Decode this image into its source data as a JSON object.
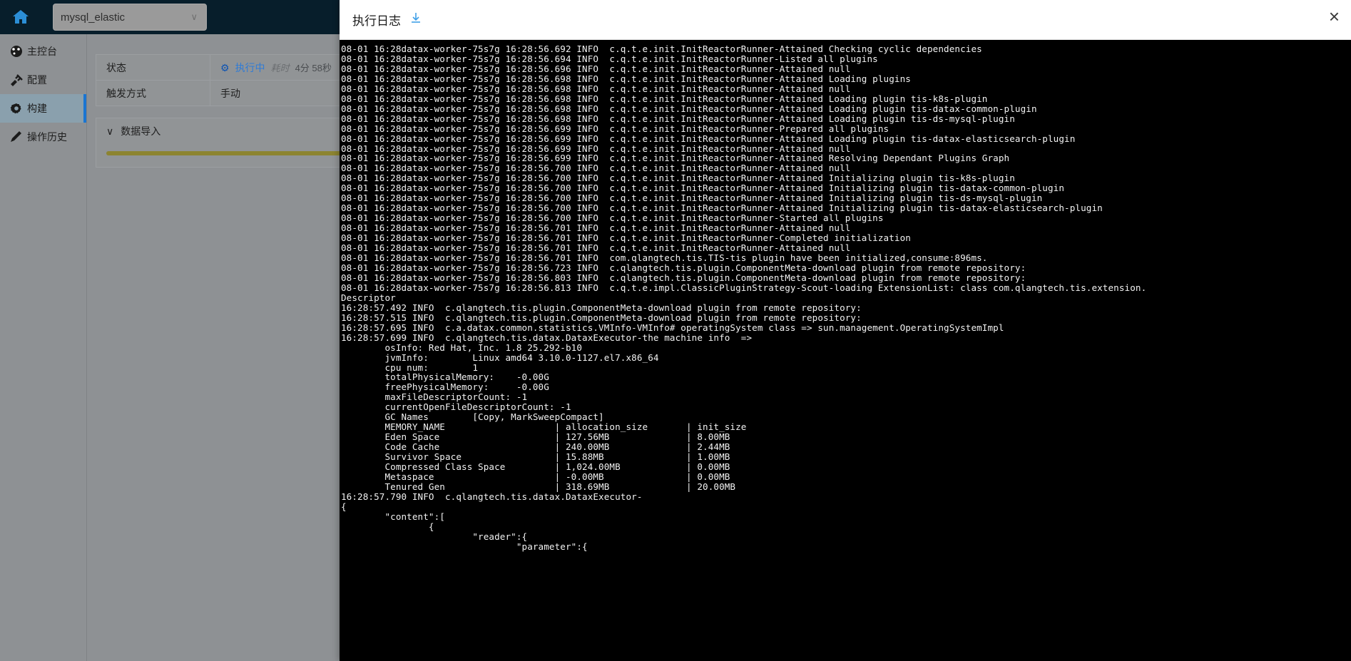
{
  "topbar": {
    "home_icon": "home-icon",
    "project_select": {
      "value": "mysql_elastic",
      "chevron": "∨"
    }
  },
  "sidebar": {
    "items": [
      {
        "label": "主控台",
        "icon": "dashboard-icon",
        "active": false
      },
      {
        "label": "配置",
        "icon": "plug-icon",
        "active": false
      },
      {
        "label": "构建",
        "icon": "gear-icon",
        "active": true
      },
      {
        "label": "操作历史",
        "icon": "pencil-icon",
        "active": false
      }
    ]
  },
  "main": {
    "info_rows": [
      {
        "label": "状态",
        "value": "执行中",
        "elapsed_prefix": "耗时",
        "elapsed_value": "4分 58秒",
        "gear": "⚙"
      },
      {
        "label": "触发方式",
        "value": "手动"
      }
    ],
    "panel": {
      "chevron": "∨",
      "title": "数据导入",
      "progress": 62
    }
  },
  "log_modal": {
    "title": "执行日志",
    "download_icon": "download-icon",
    "close_icon": "close-icon",
    "lines": [
      "08-01 16:28datax-worker-75s7g 16:28:56.692 INFO  c.q.t.e.init.InitReactorRunner-Attained Checking cyclic dependencies",
      "08-01 16:28datax-worker-75s7g 16:28:56.694 INFO  c.q.t.e.init.InitReactorRunner-Listed all plugins",
      "08-01 16:28datax-worker-75s7g 16:28:56.696 INFO  c.q.t.e.init.InitReactorRunner-Attained null",
      "08-01 16:28datax-worker-75s7g 16:28:56.698 INFO  c.q.t.e.init.InitReactorRunner-Attained Loading plugins",
      "08-01 16:28datax-worker-75s7g 16:28:56.698 INFO  c.q.t.e.init.InitReactorRunner-Attained null",
      "08-01 16:28datax-worker-75s7g 16:28:56.698 INFO  c.q.t.e.init.InitReactorRunner-Attained Loading plugin tis-k8s-plugin",
      "08-01 16:28datax-worker-75s7g 16:28:56.698 INFO  c.q.t.e.init.InitReactorRunner-Attained Loading plugin tis-datax-common-plugin",
      "08-01 16:28datax-worker-75s7g 16:28:56.698 INFO  c.q.t.e.init.InitReactorRunner-Attained Loading plugin tis-ds-mysql-plugin",
      "08-01 16:28datax-worker-75s7g 16:28:56.699 INFO  c.q.t.e.init.InitReactorRunner-Prepared all plugins",
      "08-01 16:28datax-worker-75s7g 16:28:56.699 INFO  c.q.t.e.init.InitReactorRunner-Attained Loading plugin tis-datax-elasticsearch-plugin",
      "08-01 16:28datax-worker-75s7g 16:28:56.699 INFO  c.q.t.e.init.InitReactorRunner-Attained null",
      "08-01 16:28datax-worker-75s7g 16:28:56.699 INFO  c.q.t.e.init.InitReactorRunner-Attained Resolving Dependant Plugins Graph",
      "08-01 16:28datax-worker-75s7g 16:28:56.700 INFO  c.q.t.e.init.InitReactorRunner-Attained null",
      "08-01 16:28datax-worker-75s7g 16:28:56.700 INFO  c.q.t.e.init.InitReactorRunner-Attained Initializing plugin tis-k8s-plugin",
      "08-01 16:28datax-worker-75s7g 16:28:56.700 INFO  c.q.t.e.init.InitReactorRunner-Attained Initializing plugin tis-datax-common-plugin",
      "08-01 16:28datax-worker-75s7g 16:28:56.700 INFO  c.q.t.e.init.InitReactorRunner-Attained Initializing plugin tis-ds-mysql-plugin",
      "08-01 16:28datax-worker-75s7g 16:28:56.700 INFO  c.q.t.e.init.InitReactorRunner-Attained Initializing plugin tis-datax-elasticsearch-plugin",
      "08-01 16:28datax-worker-75s7g 16:28:56.700 INFO  c.q.t.e.init.InitReactorRunner-Started all plugins",
      "08-01 16:28datax-worker-75s7g 16:28:56.701 INFO  c.q.t.e.init.InitReactorRunner-Attained null",
      "08-01 16:28datax-worker-75s7g 16:28:56.701 INFO  c.q.t.e.init.InitReactorRunner-Completed initialization",
      "08-01 16:28datax-worker-75s7g 16:28:56.701 INFO  c.q.t.e.init.InitReactorRunner-Attained null",
      "08-01 16:28datax-worker-75s7g 16:28:56.701 INFO  com.qlangtech.tis.TIS-tis plugin have been initialized,consume:896ms.",
      "08-01 16:28datax-worker-75s7g 16:28:56.723 INFO  c.qlangtech.tis.plugin.ComponentMeta-download plugin from remote repository:",
      "08-01 16:28datax-worker-75s7g 16:28:56.803 INFO  c.qlangtech.tis.plugin.ComponentMeta-download plugin from remote repository:",
      "08-01 16:28datax-worker-75s7g 16:28:56.813 INFO  c.q.t.e.impl.ClassicPluginStrategy-Scout-loading ExtensionList: class com.qlangtech.tis.extension.",
      "Descriptor",
      "16:28:57.492 INFO  c.qlangtech.tis.plugin.ComponentMeta-download plugin from remote repository:",
      "16:28:57.515 INFO  c.qlangtech.tis.plugin.ComponentMeta-download plugin from remote repository:",
      "16:28:57.695 INFO  c.a.datax.common.statistics.VMInfo-VMInfo# operatingSystem class => sun.management.OperatingSystemImpl",
      "16:28:57.699 INFO  c.qlangtech.tis.datax.DataxExecutor-the machine info  =>",
      "        osInfo: Red Hat, Inc. 1.8 25.292-b10",
      "        jvmInfo:        Linux amd64 3.10.0-1127.el7.x86_64",
      "        cpu num:        1",
      "        totalPhysicalMemory:    -0.00G",
      "        freePhysicalMemory:     -0.00G",
      "        maxFileDescriptorCount: -1",
      "        currentOpenFileDescriptorCount: -1",
      "        GC Names        [Copy, MarkSweepCompact]",
      "        MEMORY_NAME                    | allocation_size       | init_size",
      "        Eden Space                     | 127.56MB              | 8.00MB",
      "        Code Cache                     | 240.00MB              | 2.44MB",
      "        Survivor Space                 | 15.88MB               | 1.00MB",
      "        Compressed Class Space         | 1,024.00MB            | 0.00MB",
      "        Metaspace                      | -0.00MB               | 0.00MB",
      "        Tenured Gen                    | 318.69MB              | 20.00MB",
      "16:28:57.790 INFO  c.qlangtech.tis.datax.DataxExecutor-",
      "{",
      "        \"content\":[",
      "                {",
      "                        \"reader\":{",
      "                                \"parameter\":{"
    ]
  }
}
